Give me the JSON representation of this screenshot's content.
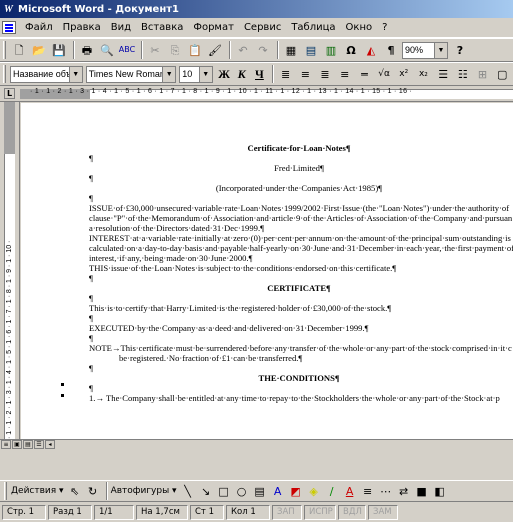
{
  "window": {
    "title": "Microsoft Word - Документ1"
  },
  "menu": [
    "Файл",
    "Правка",
    "Вид",
    "Вставка",
    "Формат",
    "Сервис",
    "Таблица",
    "Окно",
    "?"
  ],
  "toolbar": {
    "zoom": "90%",
    "icons": [
      "new-document-icon",
      "open-folder-icon",
      "save-icon",
      "print-icon",
      "print-preview-icon",
      "spelling-icon",
      "cut-icon",
      "copy-icon",
      "paste-icon",
      "format-painter-icon",
      "undo-icon",
      "redo-icon",
      "tables-borders-icon",
      "insert-table-icon",
      "insert-excel-icon",
      "insert-symbol-icon",
      "drawing-icon",
      "show-formatting-icon",
      "help-icon"
    ]
  },
  "formatting": {
    "style": "Название объек",
    "font": "Times New Roman",
    "size": "10",
    "bold": "Ж",
    "italic": "К",
    "underline": "Ч"
  },
  "ruler": {
    "horizontal": "· 1 · 1 · 2 · 1 · 3 · 1 · 4 · 1 · 5 · 1 · 6 · 1 · 7 · 1 · 8 · 1 · 9 · 1 · 10 · 1 · 11 · 1 · 12 · 1 · 13 · 1 · 14 · 1 · 15 · 1 · 16 ·",
    "vertical": "· 1 · 1 · 2 · 1 · 3 · 1 · 4 · 1 · 5 · 1 · 6 · 1 · 7 · 1 · 8 · 1 · 9 · 1 · 10 ·"
  },
  "document": {
    "title": "Certificate·for·Loan·Notes¶",
    "p1": "¶",
    "company": "Fred·Limited¶",
    "p2": "¶",
    "incorporated": "(Incorporated·under·the·Companies·Act·1985)¶",
    "p3": "¶",
    "issue1": "ISSUE·of·£30,000·unsecured·variable·rate·Loan·Notes·1999/2002·First·Issue·(the·\"Loan·Notes\")·under·the·authority·of",
    "issue2": "clause·\"P\"·of·the·Memorandum·of·Association·and·article·9·of·the·Articles·of·Association·of·the·Company·and·pursuan",
    "issue3": "a·resolution·of·the·Directors·dated·31·Dec·1999.¶",
    "interest1": "INTEREST·at·a·variable·rate·initially·at·zero·(0)·per·cent·per·annum·on·the·amount·of·the·principal·sum·outstanding·is",
    "interest2": "calculated·on·a·day-to-day·basis·and·payable·half-yearly·on·30·June·and·31·December·in·each·year,·the·first·payment·of",
    "interest3": "interest,·if·any,·being·made·on·30·June·2000.¶",
    "subject": "THIS·issue·of·the·Loan·Notes·is·subject·to·the·conditions·endorsed·on·this·certificate.¶",
    "p4": "¶",
    "certificate": "CERTIFICATE¶",
    "p5": "¶",
    "certify": "This·is·to·certify·that·Harry·Limited·is·the·registered·holder·of·£30,000·of·the·stock.¶",
    "p6": "¶",
    "executed": "EXECUTED·by·the·Company·as·a·deed·and·delivered·on·31·December·1999.¶",
    "p7": "¶",
    "note1": "NOTE→This·certificate·must·be·surrendered·before·any·transfer·of·the·whole·or·any·part·of·the·stock·comprised·in·it·c",
    "note2": "be·registered.·No·fraction·of·£1·can·be·transferred.¶",
    "p8": "¶",
    "conditions": "THE·CONDITIONS¶",
    "p9": "¶",
    "item1": "1.→ The·Company·shall·be·entitled·at·any·time·to·repay·to·the·Stockholders·the·whole·or·any·part·of·the·Stock·at·p"
  },
  "drawing": {
    "actions": "Действия ▾",
    "autoshapes": "Автофигуры ▾"
  },
  "status": {
    "page": "Стр. 1",
    "section": "Разд 1",
    "pages": "1/1",
    "at": "На 1,7см",
    "line": "Ст 1",
    "col": "Кол 1",
    "rec": "ЗАП",
    "trk": "ИСПР",
    "ext": "ВДЛ",
    "ovr": "ЗАМ"
  }
}
